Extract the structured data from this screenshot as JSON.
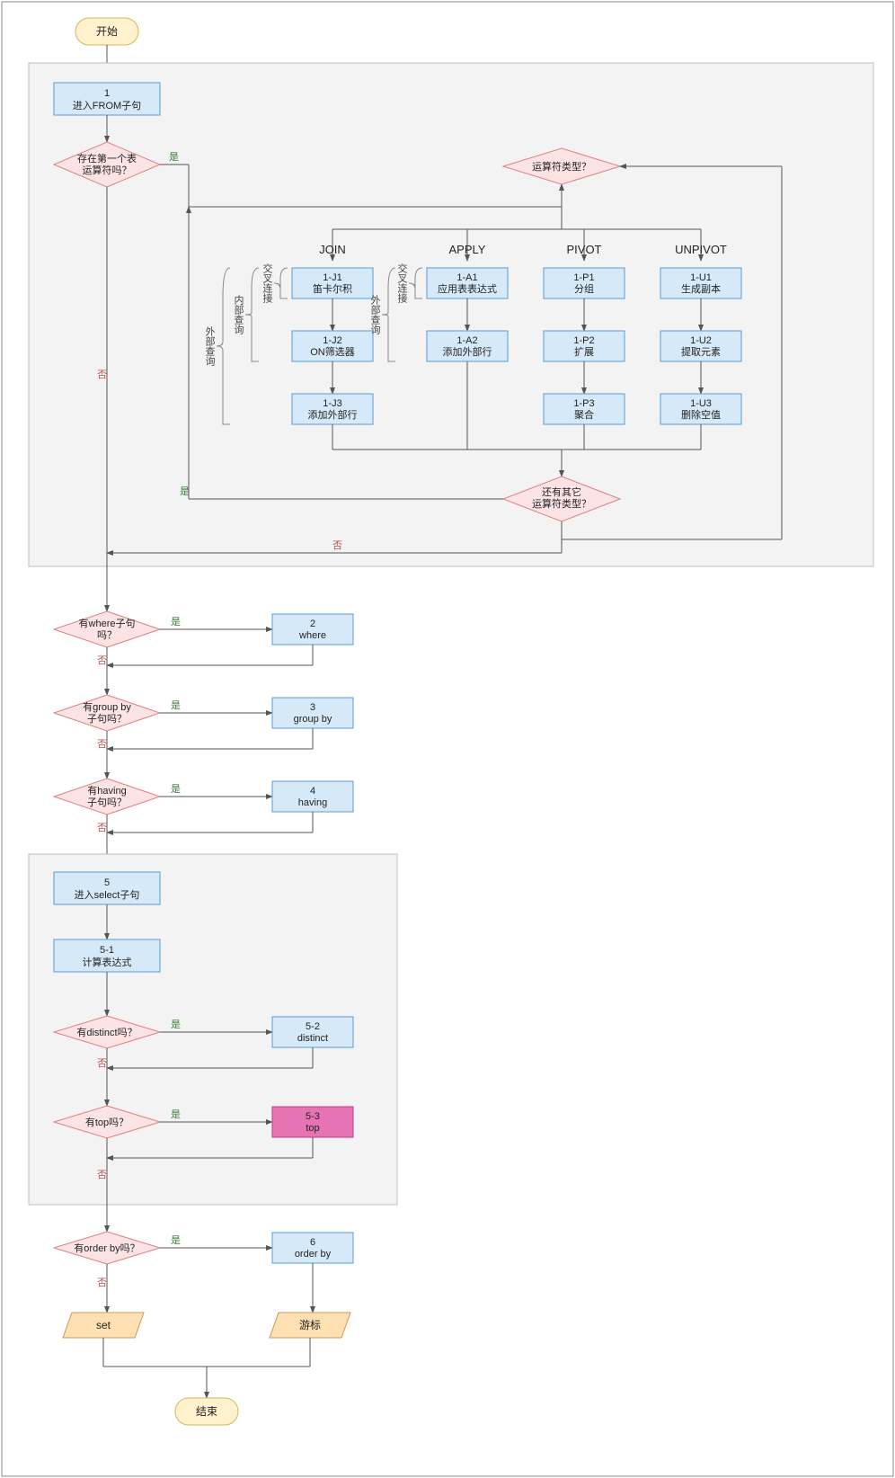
{
  "start": "开始",
  "end": "结束",
  "step1": {
    "num": "1",
    "text": "进入FROM子句"
  },
  "dec_first": "存在第一个表\n运算符吗？",
  "dec_type": "运算符类型？",
  "headers": {
    "join": "JOIN",
    "apply": "APPLY",
    "pivot": "PIVOT",
    "unpivot": "UNPIVOT"
  },
  "join": {
    "j1": {
      "num": "1-J1",
      "text": "笛卡尔积"
    },
    "j2": {
      "num": "1-J2",
      "text": "ON筛选器"
    },
    "j3": {
      "num": "1-J3",
      "text": "添加外部行"
    }
  },
  "apply": {
    "a1": {
      "num": "1-A1",
      "text": "应用表表达式"
    },
    "a2": {
      "num": "1-A2",
      "text": "添加外部行"
    }
  },
  "pivot": {
    "p1": {
      "num": "1-P1",
      "text": "分组"
    },
    "p2": {
      "num": "1-P2",
      "text": "扩展"
    },
    "p3": {
      "num": "1-P3",
      "text": "聚合"
    }
  },
  "unpivot": {
    "u1": {
      "num": "1-U1",
      "text": "生成副本"
    },
    "u2": {
      "num": "1-U2",
      "text": "提取元素"
    },
    "u3": {
      "num": "1-U3",
      "text": "删除空值"
    }
  },
  "braces": {
    "cross_join": "交叉连接",
    "inner_query": "内部查询",
    "outer_query": "外部查询",
    "cross_apply": "交叉连接",
    "outer_apply": "外部查询"
  },
  "dec_more": "还有其它\n运算符类型？",
  "dec_where": "有where子句\n吗？",
  "step2": {
    "num": "2",
    "text": "where"
  },
  "dec_groupby": "有group by\n子句吗？",
  "step3": {
    "num": "3",
    "text": "group by"
  },
  "dec_having": "有having\n子句吗？",
  "step4": {
    "num": "4",
    "text": "having"
  },
  "step5": {
    "num": "5",
    "text": "进入select子句"
  },
  "step5_1": {
    "num": "5-1",
    "text": "计算表达式"
  },
  "dec_distinct": "有distinct吗？",
  "step5_2": {
    "num": "5-2",
    "text": "distinct"
  },
  "dec_top": "有top吗？",
  "step5_3": {
    "num": "5-3",
    "text": "top"
  },
  "dec_orderby": "有order by吗？",
  "step6": {
    "num": "6",
    "text": "order by"
  },
  "para_set": "set",
  "para_cursor": "游标",
  "labels": {
    "yes": "是",
    "no": "否"
  }
}
